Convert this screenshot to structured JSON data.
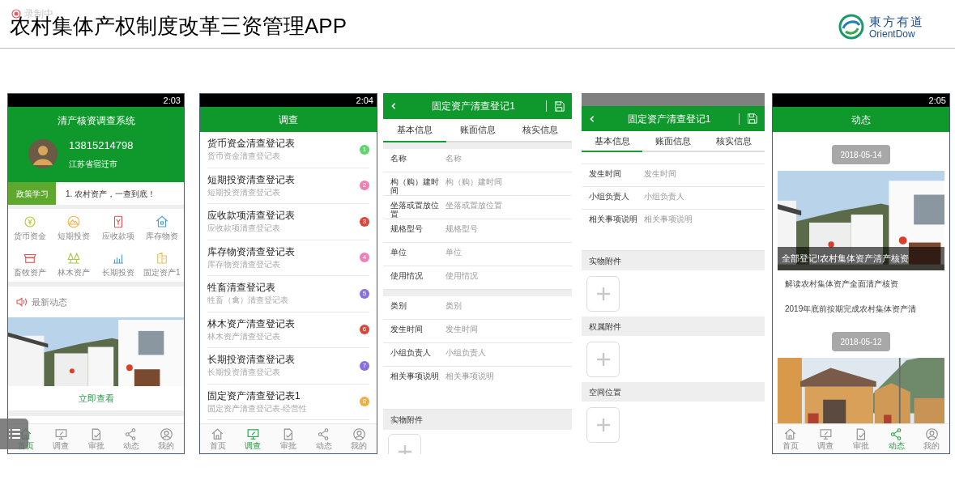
{
  "slide": {
    "title": "农村集体产权制度改革三资管理APP",
    "logo_name": "東方有道",
    "logo_latin": "OrientDow",
    "recording": "录制中"
  },
  "home": {
    "time": "2:03",
    "title": "清产核资调查系统",
    "phone": "13815214798",
    "location": "江苏省宿迁市",
    "policy_tab": "政策学习",
    "ticker": "1. 农村资产，一查到底！",
    "shortcuts": [
      "货币资金",
      "短期投资",
      "应收款项",
      "库存物资",
      "畜牧资产",
      "林木资产",
      "长期投资",
      "固定资产1"
    ],
    "news_title": "最新动态",
    "view_link": "立即查看",
    "nav": [
      {
        "label": "首页",
        "selected": true
      },
      {
        "label": "调查",
        "selected": false
      },
      {
        "label": "审批",
        "selected": false
      },
      {
        "label": "动态",
        "selected": false
      },
      {
        "label": "我的",
        "selected": false
      }
    ]
  },
  "survey": {
    "time": "2:04",
    "title": "调查",
    "items": [
      {
        "title": "货币资金清查登记表",
        "subtitle": "货币资金清查登记表",
        "number": "1",
        "color": "#5cd66a"
      },
      {
        "title": "短期投资清查登记表",
        "subtitle": "短期投资清查登记表",
        "number": "2",
        "color": "#f27fb4"
      },
      {
        "title": "应收款项清查登记表",
        "subtitle": "应收款项清查登记表",
        "number": "3",
        "color": "#d9483b"
      },
      {
        "title": "库存物资清查登记表",
        "subtitle": "库存物资清查登记表",
        "number": "4",
        "color": "#f07fb8"
      },
      {
        "title": "牲畜清查登记表",
        "subtitle": "牲畜（禽）清查登记表",
        "number": "5",
        "color": "#8b6fe0"
      },
      {
        "title": "林木资产清查登记表",
        "subtitle": "林木资产清查登记表",
        "number": "6",
        "color": "#d9483b"
      },
      {
        "title": "长期投资清查登记表",
        "subtitle": "长期投资清查登记表",
        "number": "7",
        "color": "#8b6fe0"
      },
      {
        "title": "固定资产清查登记表1",
        "subtitle": "固定资产清查登记表-经营性",
        "number": "8",
        "color": "#eeae42"
      }
    ],
    "nav": [
      {
        "label": "首页",
        "selected": false
      },
      {
        "label": "调查",
        "selected": true
      },
      {
        "label": "审批",
        "selected": false
      },
      {
        "label": "动态",
        "selected": false
      },
      {
        "label": "我的",
        "selected": false
      }
    ]
  },
  "form": {
    "title": "固定资产清查登记1",
    "tabs": [
      {
        "label": "基本信息",
        "selected": true
      },
      {
        "label": "账面信息",
        "selected": false
      },
      {
        "label": "核实信息",
        "selected": false
      }
    ],
    "groups": [
      [
        {
          "label": "名称",
          "placeholder": "名称"
        },
        {
          "label": "构（购）建时间",
          "placeholder": "构（购）建时间"
        },
        {
          "label": "坐落或置放位置",
          "placeholder": "坐落或置放位置"
        },
        {
          "label": "规格型号",
          "placeholder": "规格型号"
        },
        {
          "label": "单位",
          "placeholder": "单位"
        },
        {
          "label": "使用情况",
          "placeholder": "使用情况"
        }
      ],
      [
        {
          "label": "类别",
          "placeholder": "类别"
        },
        {
          "label": "发生时间",
          "placeholder": "发生时间"
        },
        {
          "label": "小组负责人",
          "placeholder": "小组负责人"
        },
        {
          "label": "相关事项说明",
          "placeholder": "相关事项说明"
        }
      ]
    ],
    "attachments": [
      "实物附件"
    ]
  },
  "form_scrolled": {
    "title": "固定资产清查登记1",
    "tabs": [
      {
        "label": "基本信息",
        "selected": true
      },
      {
        "label": "账面信息",
        "selected": false
      },
      {
        "label": "核实信息",
        "selected": false
      }
    ],
    "fields": [
      {
        "label": "发生时间",
        "placeholder": "发生时间"
      },
      {
        "label": "小组负责人",
        "placeholder": "小组负责人"
      },
      {
        "label": "相关事项说明",
        "placeholder": "相关事项说明"
      }
    ],
    "attachments": [
      "实物附件",
      "权属附件",
      "空间位置"
    ]
  },
  "feed": {
    "time": "2:05",
    "title": "动态",
    "posts": [
      {
        "date": "2018-05-14",
        "headline": "全部登记!农村集体资产清产核资",
        "links": [
          "解读农村集体资产全面清产核资",
          "2019年底前按期完成农村集体资产清"
        ]
      },
      {
        "date": "2018-05-12"
      }
    ],
    "nav": [
      {
        "label": "首页",
        "selected": false
      },
      {
        "label": "调查",
        "selected": false
      },
      {
        "label": "审批",
        "selected": false
      },
      {
        "label": "动态",
        "selected": true
      },
      {
        "label": "我的",
        "selected": false
      }
    ]
  }
}
